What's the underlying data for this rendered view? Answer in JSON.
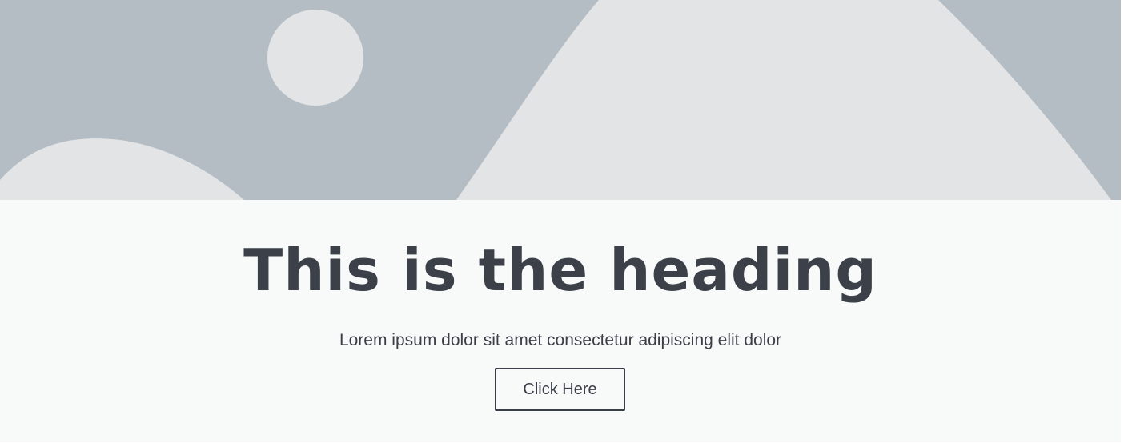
{
  "hero": {
    "image_icon": "image-placeholder-icon",
    "colors": {
      "sky": "#b5bdc4",
      "shapes": "#e3e4e6"
    }
  },
  "content": {
    "heading": "This is the heading",
    "subtext": "Lorem ipsum dolor sit amet consectetur adipiscing elit dolor",
    "button_label": "Click Here"
  },
  "colors": {
    "text": "#3c4149",
    "background": "#f8f9f9"
  }
}
